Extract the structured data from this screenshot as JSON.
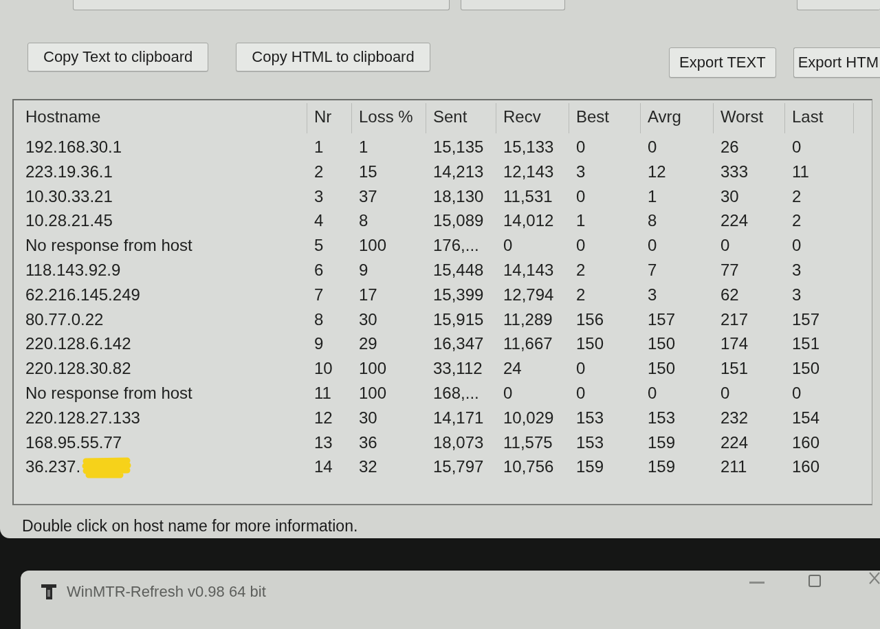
{
  "toolbar": {
    "copy_buttons": [
      "Copy Text to clipboard",
      "Copy HTML to clipboard"
    ],
    "export_buttons": [
      "Export TEXT",
      "Export HTM"
    ]
  },
  "table": {
    "columns": [
      "Hostname",
      "Nr",
      "Loss %",
      "Sent",
      "Recv",
      "Best",
      "Avrg",
      "Worst",
      "Last"
    ],
    "rows": [
      {
        "cells": [
          "192.168.30.1",
          "1",
          "1",
          "15,135",
          "15,133",
          "0",
          "0",
          "26",
          "0"
        ],
        "redacted": false
      },
      {
        "cells": [
          "223.19.36.1",
          "2",
          "15",
          "14,213",
          "12,143",
          "3",
          "12",
          "333",
          "11"
        ],
        "redacted": false
      },
      {
        "cells": [
          "10.30.33.21",
          "3",
          "37",
          "18,130",
          "11,531",
          "0",
          "1",
          "30",
          "2"
        ],
        "redacted": false
      },
      {
        "cells": [
          "10.28.21.45",
          "4",
          "8",
          "15,089",
          "14,012",
          "1",
          "8",
          "224",
          "2"
        ],
        "redacted": false
      },
      {
        "cells": [
          "No response from host",
          "5",
          "100",
          "176,...",
          "0",
          "0",
          "0",
          "0",
          "0"
        ],
        "redacted": false
      },
      {
        "cells": [
          "118.143.92.9",
          "6",
          "9",
          "15,448",
          "14,143",
          "2",
          "7",
          "77",
          "3"
        ],
        "redacted": false
      },
      {
        "cells": [
          "62.216.145.249",
          "7",
          "17",
          "15,399",
          "12,794",
          "2",
          "3",
          "62",
          "3"
        ],
        "redacted": false
      },
      {
        "cells": [
          "80.77.0.22",
          "8",
          "30",
          "15,915",
          "11,289",
          "156",
          "157",
          "217",
          "157"
        ],
        "redacted": false
      },
      {
        "cells": [
          "220.128.6.142",
          "9",
          "29",
          "16,347",
          "11,667",
          "150",
          "150",
          "174",
          "151"
        ],
        "redacted": false
      },
      {
        "cells": [
          "220.128.30.82",
          "10",
          "100",
          "33,112",
          "24",
          "0",
          "150",
          "151",
          "150"
        ],
        "redacted": false
      },
      {
        "cells": [
          "No response from host",
          "11",
          "100",
          "168,...",
          "0",
          "0",
          "0",
          "0",
          "0"
        ],
        "redacted": false
      },
      {
        "cells": [
          "220.128.27.133",
          "12",
          "30",
          "14,171",
          "10,029",
          "153",
          "153",
          "232",
          "154"
        ],
        "redacted": false
      },
      {
        "cells": [
          "168.95.55.77",
          "13",
          "36",
          "18,073",
          "11,575",
          "153",
          "159",
          "224",
          "160"
        ],
        "redacted": false
      },
      {
        "cells": [
          "36.237.",
          "14",
          "32",
          "15,797",
          "10,756",
          "159",
          "159",
          "211",
          "160"
        ],
        "redacted": true
      }
    ]
  },
  "status_bar": {
    "text": "Double click on host name for more information."
  },
  "second_window": {
    "title": "WinMTR-Refresh v0.98 64 bit"
  }
}
